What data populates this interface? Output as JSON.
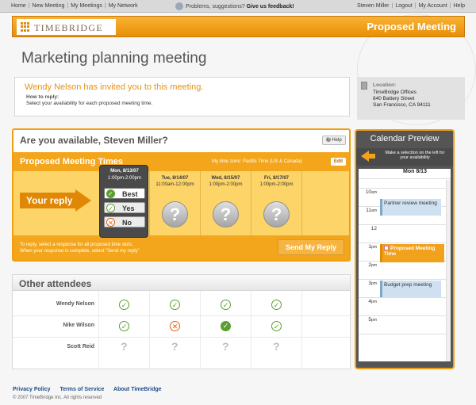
{
  "topnav": {
    "left": [
      "Home",
      "New Meeting",
      "My Meetings",
      "My Network"
    ],
    "feedback_prefix": "Problems, suggestions?",
    "feedback_link": "Give us feedback!",
    "user": "Steven Miller",
    "right": [
      "Logout",
      "My Account",
      "Help"
    ]
  },
  "header": {
    "logo": "TIMEBRIDGE",
    "page": "Proposed Meeting"
  },
  "meeting_title": "Marketing planning meeting",
  "invite": {
    "headline": "Wendy Nelson has invited you to this meeting.",
    "how_label": "How to reply:",
    "instruction": "Select your availability for each proposed meeting time."
  },
  "location": {
    "label": "Location:",
    "lines": [
      "TimeBridge Offices",
      "840 Battery Street",
      "San Francisco, CA 94111"
    ]
  },
  "availability": {
    "question": "Are you available, Steven Miller?",
    "help": "Help",
    "proposed_title": "Proposed Meeting Times",
    "timezone": "My time zone: Pacific Time (US & Canada)",
    "edit": "Edit",
    "your_reply": "Your reply",
    "slots": [
      {
        "date": "Mon, 8/13/07",
        "time": "1:00pm-2:00pm"
      },
      {
        "date": "Tue, 8/14/07",
        "time": "11:00am-12:00pm"
      },
      {
        "date": "Wed, 8/15/07",
        "time": "1:00pm-2:00pm"
      },
      {
        "date": "Fri, 8/17/07",
        "time": "1:00pm-2:00pm"
      }
    ],
    "options": [
      "Best",
      "Yes",
      "No"
    ],
    "instr1": "To reply, select a response for all proposed time slots.",
    "instr2": "When your response is complete, select \"Send my reply\"",
    "send": "Send My Reply"
  },
  "others": {
    "title": "Other attendees",
    "rows": [
      {
        "name": "Wendy Nelson",
        "r": [
          "yes",
          "yes",
          "yes",
          "yes"
        ]
      },
      {
        "name": "Nike Wilson",
        "r": [
          "yes",
          "no",
          "best",
          "yes"
        ]
      },
      {
        "name": "Scott Reid",
        "r": [
          "?",
          "?",
          "?",
          "?"
        ]
      }
    ]
  },
  "calendar": {
    "title": "Calendar Preview",
    "hint": "Make a selection on the left for your availability",
    "day": "Mon 8/13",
    "hours": [
      "10",
      "11",
      "12",
      "1",
      "2",
      "3",
      "4",
      "5"
    ],
    "suffixes": [
      "am",
      "am",
      "",
      "pm",
      "pm",
      "pm",
      "pm",
      "pm"
    ],
    "events": [
      "Partner review meeting",
      "Proposed Meeting Time",
      "Budget prep meeting"
    ]
  },
  "footer": {
    "links": [
      "Privacy Policy",
      "Terms of Service",
      "About TimeBridge"
    ],
    "copyright": "© 2007 TimeBridge Inc. All rights reserved"
  },
  "colors": {
    "accent": "#f3a61c",
    "accent_dark": "#e08806",
    "link": "#1c4c8a",
    "yes_green": "#5aa02c",
    "no_red": "#e06010"
  }
}
